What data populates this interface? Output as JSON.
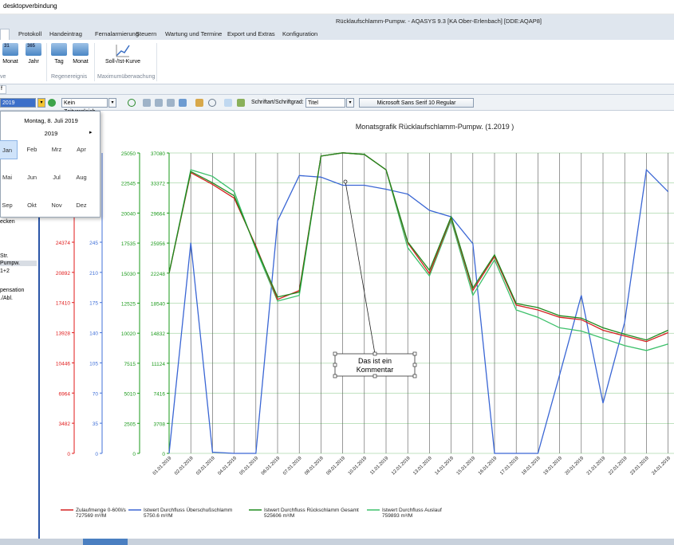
{
  "window": {
    "title": "desktopverbindung",
    "app_title": "Rücklaufschlamm-Pumpw. - AQASYS 9.3 [KA Ober-Erlenbach] [DDE:AQAP8]"
  },
  "menu": {
    "items": [
      "Protokoll",
      "Handeintrag",
      "Fernalarmierung",
      "Steuern",
      "Wartung und Termine",
      "Export und Extras",
      "Konfiguration"
    ]
  },
  "ribbon": {
    "buttons": [
      "Monat",
      "Jahr",
      "Tag",
      "Monat",
      "Soll-/Ist-Kurve"
    ],
    "groups": [
      "ve",
      "Regenereignis",
      "Maximumüberwachung"
    ]
  },
  "toolbar": {
    "date_value": "2019",
    "compare": "Kein Zeitvergleich",
    "font_label": "Schriftart/Schriftgrad:",
    "font_target": "Titel",
    "font_value": "Microsoft Sans Serif 10 Regular"
  },
  "calendar": {
    "header": "Montag, 8. Juli 2019",
    "year": "2019",
    "months": [
      "Jan",
      "Feb",
      "Mrz",
      "Apr",
      "Mai",
      "Jun",
      "Jul",
      "Aug",
      "Sep",
      "Okt",
      "Nov",
      "Dez"
    ],
    "selected": "Jan"
  },
  "left_panel": {
    "items": [
      "ecken",
      "Str.",
      "Pumpw.",
      "1+2",
      "pensation",
      "./Abl."
    ]
  },
  "comment": {
    "line1": "Das ist ein",
    "line2": "Kommentar"
  },
  "chart_data": {
    "type": "line",
    "title": "Monatsgrafik Rücklaufschlamm-Pumpw. (1.2019 )",
    "x": [
      "01.01.2019",
      "02.01.2019",
      "03.01.2019",
      "04.01.2019",
      "05.01.2019",
      "06.01.2019",
      "07.01.2019",
      "08.01.2019",
      "09.01.2019",
      "10.01.2019",
      "11.01.2019",
      "12.01.2019",
      "13.01.2019",
      "14.01.2019",
      "15.01.2019",
      "16.01.2019",
      "17.01.2019",
      "18.01.2019",
      "19.01.2019",
      "20.01.2019",
      "21.01.2019",
      "22.01.2019",
      "23.01.2019",
      "24.01.2019"
    ],
    "axes": [
      {
        "color": "#e01818",
        "ticks": [
          "24374",
          "20892",
          "17410",
          "13928",
          "10446",
          "6964",
          "3482",
          "0"
        ],
        "min": 0,
        "step": 3482
      },
      {
        "color": "#4070d8",
        "ticks": [
          "245",
          "210",
          "175",
          "140",
          "105",
          "70",
          "35",
          "0"
        ],
        "min": 0,
        "step": 35
      },
      {
        "color": "#1a9a1a",
        "ticks": [
          "25050",
          "22545",
          "20040",
          "17535",
          "15030",
          "12525",
          "10020",
          "7515",
          "5010",
          "2505",
          "0"
        ],
        "min": 0,
        "max": 25050
      },
      {
        "color": "#1a9a1a",
        "ticks": [
          "37080",
          "33372",
          "29664",
          "25956",
          "22248",
          "18540",
          "14832",
          "11124",
          "7416",
          "3708",
          "0"
        ],
        "min": 0,
        "max": 37080
      }
    ],
    "series": [
      {
        "name": "Zulaufmenge 0-600l/s",
        "sub": "727569 m³/M",
        "color": "#d42020",
        "axis": 3,
        "values": [
          22248,
          34650,
          33200,
          31500,
          25600,
          19000,
          20100,
          36700,
          37100,
          36900,
          35000,
          26000,
          22200,
          29100,
          20100,
          24300,
          18300,
          17700,
          16800,
          16500,
          15200,
          14500,
          13800,
          14900
        ]
      },
      {
        "name": "Istwert Durchfluss Überschußschlamm",
        "sub": "5750.6 m³/M",
        "color": "#3a66d4",
        "axis": 3,
        "values": [
          0,
          26000,
          150,
          0,
          0,
          28700,
          34300,
          34100,
          33100,
          33100,
          32600,
          32000,
          30000,
          29200,
          25900,
          0,
          0,
          0,
          9700,
          19500,
          6200,
          16200,
          35000,
          32300
        ]
      },
      {
        "name": "Istwert Durchfluss Rückschlamm Gesamt",
        "sub": "525606 m³/M",
        "color": "#1e8a1e",
        "axis": 3,
        "values": [
          22248,
          34800,
          33400,
          31800,
          25400,
          19300,
          19900,
          36700,
          37100,
          36900,
          35000,
          26100,
          22600,
          29200,
          20400,
          24500,
          18500,
          18000,
          17000,
          16700,
          15500,
          14700,
          14000,
          15200
        ]
      },
      {
        "name": "Istwert Durchfluss Auslauf",
        "sub": "759893 m³/M",
        "color": "#3cc06a",
        "axis": 3,
        "values": [
          22248,
          35000,
          34200,
          32300,
          25200,
          18800,
          19500,
          36700,
          37100,
          36900,
          35000,
          25400,
          21900,
          28800,
          19500,
          23900,
          17700,
          16800,
          15500,
          15100,
          14200,
          13300,
          12700,
          13500
        ]
      }
    ]
  }
}
